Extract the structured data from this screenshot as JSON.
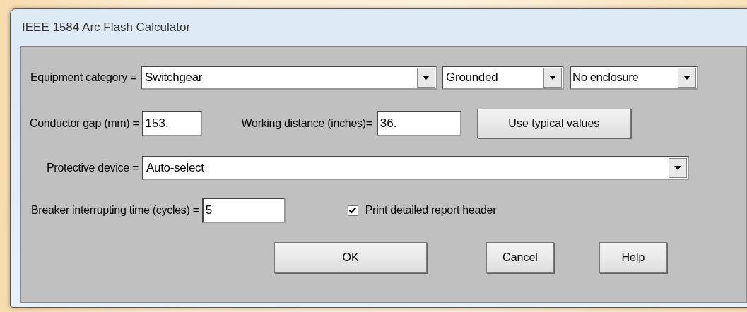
{
  "window": {
    "title": "IEEE 1584 Arc Flash Calculator"
  },
  "equipment": {
    "label": "Equipment category =",
    "category": "Switchgear",
    "grounding": "Grounded",
    "enclosure": "No enclosure"
  },
  "conductor_gap": {
    "label": "Conductor gap (mm) =",
    "value": "153."
  },
  "working_distance": {
    "label": "Working distance (inches)=",
    "value": "36."
  },
  "typical_button": "Use typical values",
  "protective_device": {
    "label": "Protective device =",
    "value": "Auto-select"
  },
  "breaker_time": {
    "label": "Breaker interrupting time (cycles) =",
    "value": "5"
  },
  "report_header": {
    "label": "Print detailed report header",
    "checked": true
  },
  "buttons": [
    "OK",
    "Cancel",
    "Help"
  ]
}
